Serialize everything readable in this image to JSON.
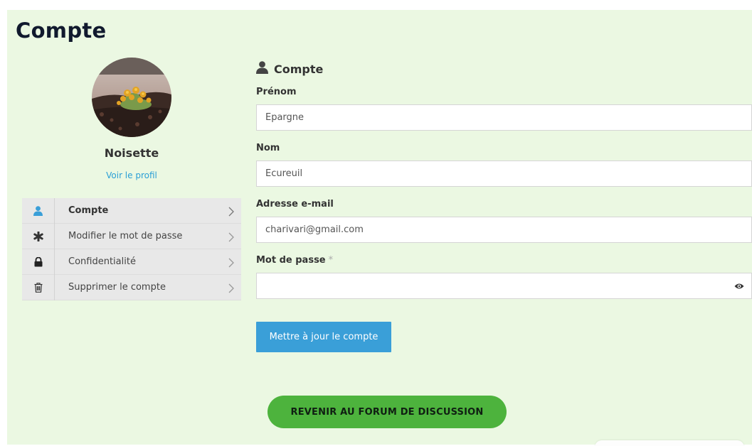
{
  "page": {
    "title": "Compte"
  },
  "profile": {
    "name": "Noisette",
    "profile_link": "Voir le profil",
    "avatar_alt": "avatar"
  },
  "nav": {
    "items": [
      {
        "label": "Compte",
        "icon": "user-icon",
        "active": true
      },
      {
        "label": "Modifier le mot de passe",
        "icon": "asterisk-icon",
        "active": false
      },
      {
        "label": "Confidentialité",
        "icon": "lock-icon",
        "active": false
      },
      {
        "label": "Supprimer le compte",
        "icon": "trash-icon",
        "active": false
      }
    ]
  },
  "form": {
    "section_title": "Compte",
    "first_name": {
      "label": "Prénom",
      "value": "Epargne"
    },
    "last_name": {
      "label": "Nom",
      "value": "Ecureuil"
    },
    "email": {
      "label": "Adresse e-mail",
      "value": "charivari@gmail.com"
    },
    "password": {
      "label": "Mot de passe",
      "required_mark": "*",
      "value": ""
    },
    "submit_label": "Mettre à jour le compte"
  },
  "forum_button": {
    "label": "REVENIR AU FORUM DE DISCUSSION"
  },
  "colors": {
    "panel_bg": "#ebf8e2",
    "accent_blue": "#3a9fd8",
    "link_blue": "#2a9fd6",
    "forum_green": "#4db33d",
    "title_dark": "#111a2e"
  }
}
